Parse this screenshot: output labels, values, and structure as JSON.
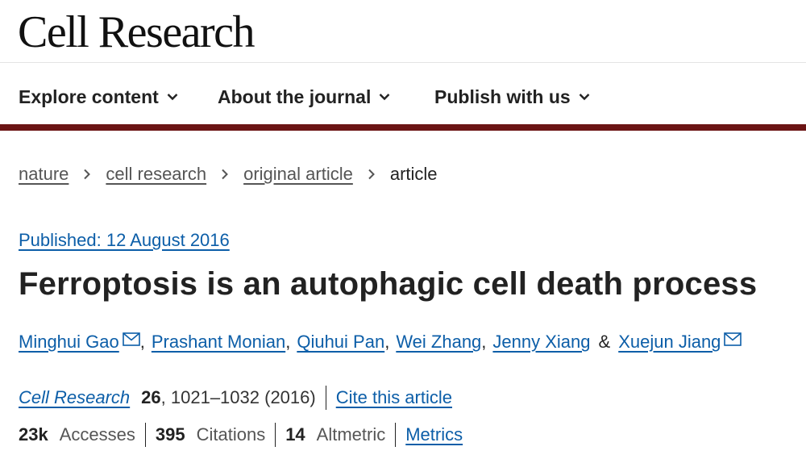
{
  "header": {
    "logo": "Cell Research"
  },
  "nav": {
    "items": [
      {
        "label": "Explore content",
        "icon": "chevron-down-icon"
      },
      {
        "label": "About the journal",
        "icon": "chevron-down-icon"
      },
      {
        "label": "Publish with us",
        "icon": "chevron-down-icon"
      }
    ]
  },
  "breadcrumb": {
    "items": [
      "nature",
      "cell research",
      "original article"
    ],
    "current": "article",
    "separator_icon": "chevron-right-icon"
  },
  "article": {
    "published": "Published: 12 August 2016",
    "title": "Ferroptosis is an autophagic cell death process",
    "authors": [
      {
        "name": "Minghui Gao",
        "email_icon": true
      },
      {
        "name": "Prashant Monian",
        "email_icon": false
      },
      {
        "name": "Qiuhui Pan",
        "email_icon": false
      },
      {
        "name": "Wei Zhang",
        "email_icon": false
      },
      {
        "name": "Jenny Xiang",
        "email_icon": false
      },
      {
        "name": "Xuejun Jiang",
        "email_icon": true
      }
    ],
    "author_separator": ",",
    "author_last_separator": "&",
    "citation": {
      "journal": "Cell Research",
      "volume": "26",
      "pages": ", 1021–1032 (2016)",
      "cite_link": "Cite this article"
    },
    "metrics": {
      "accesses_value": "23k",
      "accesses_label": "Accesses",
      "citations_value": "395",
      "citations_label": "Citations",
      "altmetric_value": "14",
      "altmetric_label": "Altmetric",
      "metrics_link": "Metrics"
    }
  },
  "colors": {
    "accent_bar": "#6b1414",
    "link": "#0c5ea8",
    "text": "#222222"
  }
}
